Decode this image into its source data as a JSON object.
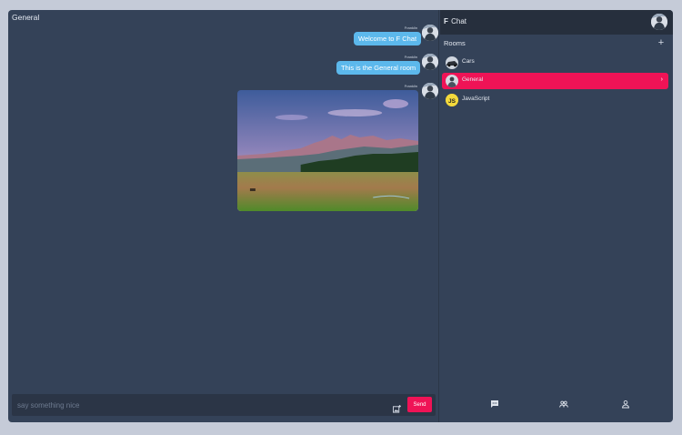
{
  "chat": {
    "room_title": "General",
    "messages": [
      {
        "author": "Franklin",
        "text": "Welcome to F Chat"
      },
      {
        "author": "Franklin",
        "text": "This is the General room"
      },
      {
        "author": "Franklin",
        "type": "image",
        "image": "mountain-landscape-photo"
      }
    ],
    "composer": {
      "placeholder": "say something nice",
      "value": "",
      "send_label": "Send",
      "attach_icon": "image-add-icon"
    }
  },
  "sidebar": {
    "brand_letter": "F",
    "brand_name": "Chat",
    "rooms_title": "Rooms",
    "add_icon": "plus-icon",
    "rooms": [
      {
        "label": "Cars",
        "active": false
      },
      {
        "label": "General",
        "active": true
      },
      {
        "label": "JavaScript",
        "active": false,
        "avatar_text": "JS"
      }
    ],
    "nav": [
      "chat-icon",
      "people-icon",
      "person-icon"
    ]
  },
  "colors": {
    "background": "#c5cbd8",
    "panel": "#344258",
    "header": "#262f3d",
    "bubble": "#5cb8ec",
    "accent": "#ef1356"
  }
}
